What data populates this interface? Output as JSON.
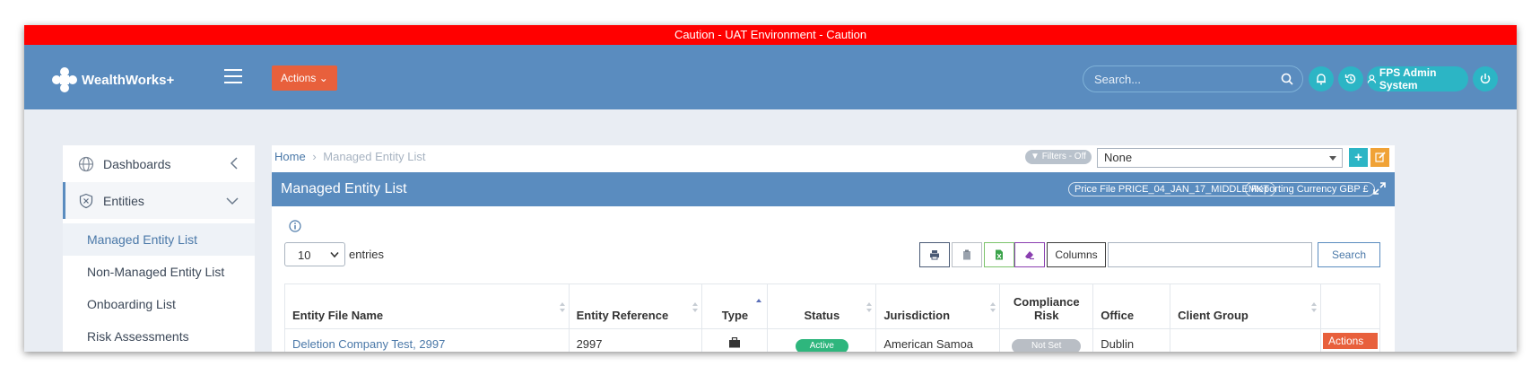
{
  "banner": {
    "text": "Caution - UAT Environment - Caution"
  },
  "header": {
    "logo_text": "WealthWorks+",
    "actions_label": "Actions",
    "search_placeholder": "Search...",
    "user_label": "FPS Admin System"
  },
  "sidebar": {
    "items": [
      {
        "label": "Dashboards",
        "icon": "globe-icon"
      },
      {
        "label": "Entities",
        "icon": "shield-icon"
      }
    ],
    "sub_items": [
      {
        "label": "Managed Entity List"
      },
      {
        "label": "Non-Managed Entity List"
      },
      {
        "label": "Onboarding List"
      },
      {
        "label": "Risk Assessments"
      }
    ]
  },
  "breadcrumb": {
    "home": "Home",
    "current": "Managed Entity List"
  },
  "filters": {
    "label": "Filters - Off",
    "select_value": "None"
  },
  "panel": {
    "title": "Managed Entity List",
    "price_file": "Price File PRICE_04_JAN_17_MIDDLEMKT",
    "reporting_currency": "Reporting Currency GBP £"
  },
  "table_controls": {
    "page_length": "10",
    "entries_label": "entries",
    "columns_label": "Columns",
    "search_label": "Search",
    "search_value": ""
  },
  "table": {
    "headers": [
      "Entity File Name",
      "Entity Reference",
      "Type",
      "Status",
      "Jurisdiction",
      "Compliance Risk",
      "Office",
      "Client Group",
      ""
    ],
    "rows": [
      {
        "name": "Deletion Company Test, 2997",
        "reference": "2997",
        "type_icon": "briefcase-icon",
        "status": "Active",
        "jurisdiction": "American Samoa",
        "risk": "Not Set",
        "office": "Dublin",
        "client_group": "",
        "action": "Actions"
      }
    ]
  },
  "colors": {
    "banner": "#ff0000",
    "header": "#5a8cbf",
    "accent_orange": "#e8603c",
    "teal": "#2cb5c5",
    "status_active": "#2eb67d",
    "risk_not_set": "#b9bec5"
  }
}
